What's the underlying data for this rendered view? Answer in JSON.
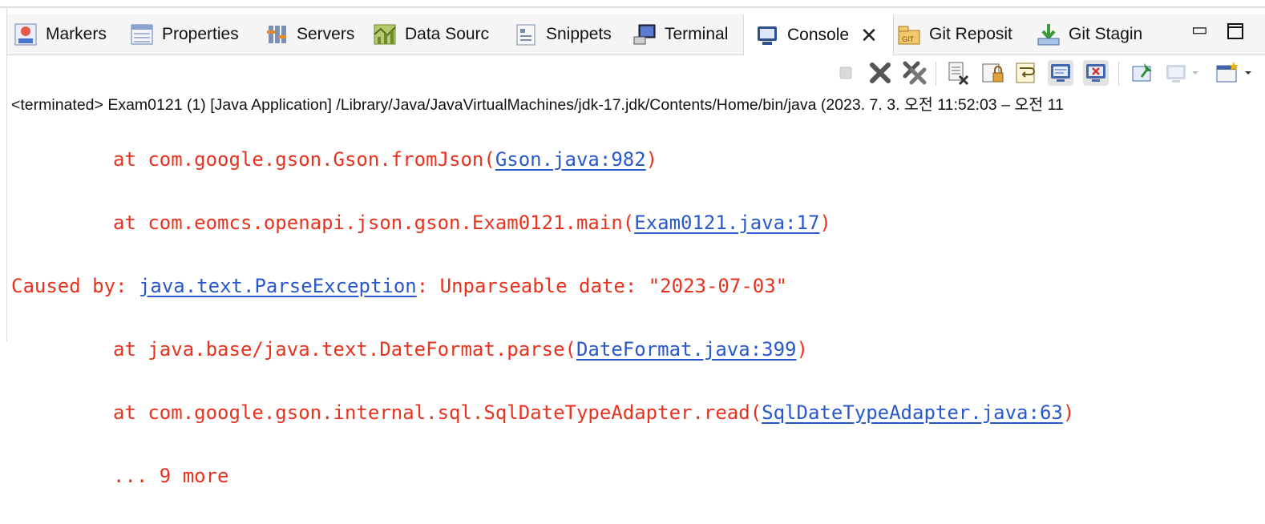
{
  "tabs": [
    {
      "label": "Markers",
      "icon": "markers-icon"
    },
    {
      "label": "Properties",
      "icon": "properties-icon"
    },
    {
      "label": "Servers",
      "icon": "servers-icon"
    },
    {
      "label": "Data Sourc",
      "icon": "data-source-icon"
    },
    {
      "label": "Snippets",
      "icon": "snippets-icon"
    },
    {
      "label": "Terminal",
      "icon": "terminal-icon"
    },
    {
      "label": "Console",
      "icon": "console-icon",
      "active": true
    },
    {
      "label": "Git Reposit",
      "icon": "git-repository-icon"
    },
    {
      "label": "Git Stagin",
      "icon": "git-staging-icon"
    }
  ],
  "status": "<terminated> Exam0121 (1) [Java Application] /Library/Java/JavaVirtualMachines/jdk-17.jdk/Contents/Home/bin/java  (2023. 7. 3. 오전 11:52:03 – 오전 11",
  "console": {
    "lines": [
      {
        "prefix": "at com.google.gson.Gson.fromJson(",
        "link": "Gson.java:982",
        "suffix": ")"
      },
      {
        "prefix": "at com.eomcs.openapi.json.gson.Exam0121.main(",
        "link": "Exam0121.java:17",
        "suffix": ")"
      },
      {
        "lead": "Caused by: ",
        "link": "java.text.ParseException",
        "suffix": ": Unparseable date: \"2023-07-03\""
      },
      {
        "prefix": "at java.base/java.text.DateFormat.parse(",
        "link": "DateFormat.java:399",
        "suffix": ")"
      },
      {
        "prefix": "at com.google.gson.internal.sql.SqlDateTypeAdapter.read(",
        "link": "SqlDateTypeAdapter.java:63",
        "suffix": ")"
      },
      {
        "prefix": "... 9 more"
      }
    ]
  },
  "colors": {
    "error_text": "#e8321e",
    "link": "#2957cc"
  }
}
